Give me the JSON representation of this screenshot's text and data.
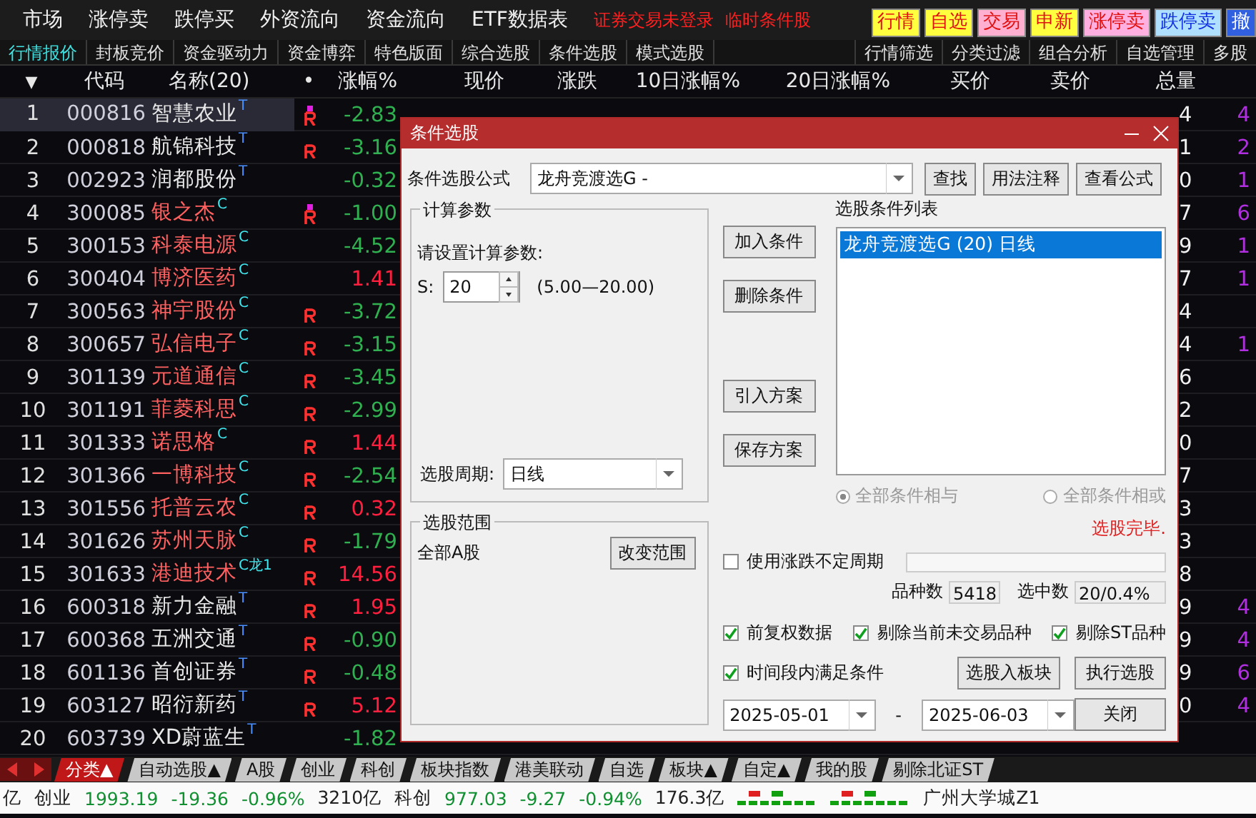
{
  "menu": {
    "items": [
      "市场",
      "涨停卖",
      "跌停买",
      "外资流向",
      "资金流向",
      "ETF数据表"
    ],
    "notices": [
      {
        "text": "证券交易未登录",
        "color": "#ff2020"
      },
      {
        "text": "临时条件股",
        "color": "#ff2020"
      }
    ],
    "quick_buttons": [
      {
        "label": "行情",
        "color": "#ffff40",
        "kind": "warm"
      },
      {
        "label": "自选",
        "color": "#ffff40",
        "kind": "warm"
      },
      {
        "label": "交易",
        "color": "#ffb0d0",
        "kind": "warm"
      },
      {
        "label": "申新",
        "color": "#ffff40",
        "kind": "warm"
      },
      {
        "label": "涨停卖",
        "color": "#ffb0e0",
        "kind": "warm"
      },
      {
        "label": "跌停卖",
        "color": "#b0e0ff",
        "kind": "cool"
      },
      {
        "label": "撤",
        "color": "#3060e0",
        "kind": "solid"
      }
    ]
  },
  "view_tabs": [
    {
      "label": "行情报价",
      "selected": true
    },
    {
      "label": "封板竞价",
      "selected": false
    },
    {
      "label": "资金驱动力",
      "selected": false
    },
    {
      "label": "资金博弈",
      "selected": false
    },
    {
      "label": "特色版面",
      "selected": false
    },
    {
      "label": "综合选股",
      "selected": false
    },
    {
      "label": "条件选股",
      "selected": false
    },
    {
      "label": "模式选股",
      "selected": false
    }
  ],
  "tools": [
    "行情筛选",
    "分类过滤",
    "组合分析",
    "自选管理",
    "多股"
  ],
  "table": {
    "columns": [
      "▼",
      "代码",
      "名称(20)",
      "•",
      "涨幅%",
      "现价",
      "涨跌",
      "10日涨幅%",
      "20日涨幅%",
      "买价",
      "卖价",
      "总量"
    ],
    "rows": [
      {
        "no": "1",
        "code": "000816",
        "selected": true,
        "name": {
          "text": "智慧农业",
          "color": "#e8e8e8"
        },
        "tag": {
          "text": "T",
          "color": "#4a90ff"
        },
        "r_badge": true,
        "dot": true,
        "change": {
          "text": "-2.83",
          "color": "#30b050"
        },
        "tail": "4",
        "tail_2": "4"
      },
      {
        "no": "2",
        "code": "000818",
        "selected": false,
        "name": {
          "text": "航锦科技",
          "color": "#e8e8e8"
        },
        "tag": {
          "text": "T",
          "color": "#4a90ff"
        },
        "r_badge": true,
        "dot": false,
        "change": {
          "text": "-3.16",
          "color": "#30b050"
        },
        "tail": "1",
        "tail_2": "2"
      },
      {
        "no": "3",
        "code": "002923",
        "selected": false,
        "name": {
          "text": "润都股份",
          "color": "#e8e8e8"
        },
        "tag": {
          "text": "T",
          "color": "#4a90ff"
        },
        "r_badge": false,
        "dot": false,
        "change": {
          "text": "-0.32",
          "color": "#30b050"
        },
        "tail": "0",
        "tail_2": "1"
      },
      {
        "no": "4",
        "code": "300085",
        "selected": false,
        "name": {
          "text": "银之杰",
          "color": "#ff6060"
        },
        "tag": {
          "text": "C",
          "color": "#40e8f0"
        },
        "r_badge": true,
        "dot": true,
        "change": {
          "text": "-1.00",
          "color": "#30b050"
        },
        "tail": "7",
        "tail_2": "6"
      },
      {
        "no": "5",
        "code": "300153",
        "selected": false,
        "name": {
          "text": "科泰电源",
          "color": "#ff6060"
        },
        "tag": {
          "text": "C",
          "color": "#40e8f0"
        },
        "r_badge": false,
        "dot": false,
        "change": {
          "text": "-4.52",
          "color": "#30b050"
        },
        "tail": "9",
        "tail_2": "1"
      },
      {
        "no": "6",
        "code": "300404",
        "selected": false,
        "name": {
          "text": "博济医药",
          "color": "#ff6060"
        },
        "tag": {
          "text": "C",
          "color": "#40e8f0"
        },
        "r_badge": false,
        "dot": false,
        "change": {
          "text": "1.41",
          "color": "#ff2040"
        },
        "tail": "7",
        "tail_2": "1"
      },
      {
        "no": "7",
        "code": "300563",
        "selected": false,
        "name": {
          "text": "神宇股份",
          "color": "#ff6060"
        },
        "tag": {
          "text": "C",
          "color": "#40e8f0"
        },
        "r_badge": true,
        "dot": false,
        "change": {
          "text": "-3.72",
          "color": "#30b050"
        },
        "tail": "4"
      },
      {
        "no": "8",
        "code": "300657",
        "selected": false,
        "name": {
          "text": "弘信电子",
          "color": "#ff6060"
        },
        "tag": {
          "text": "C",
          "color": "#40e8f0"
        },
        "r_badge": true,
        "dot": false,
        "change": {
          "text": "-3.15",
          "color": "#30b050"
        },
        "tail": "4",
        "tail_2": "1"
      },
      {
        "no": "9",
        "code": "301139",
        "selected": false,
        "name": {
          "text": "元道通信",
          "color": "#ff6060"
        },
        "tag": {
          "text": "C",
          "color": "#40e8f0"
        },
        "r_badge": true,
        "dot": false,
        "change": {
          "text": "-3.45",
          "color": "#30b050"
        },
        "tail": "6"
      },
      {
        "no": "10",
        "code": "301191",
        "selected": false,
        "name": {
          "text": "菲菱科思",
          "color": "#ff6060"
        },
        "tag": {
          "text": "C",
          "color": "#40e8f0"
        },
        "r_badge": true,
        "dot": false,
        "change": {
          "text": "-2.99",
          "color": "#30b050"
        },
        "tail": "2"
      },
      {
        "no": "11",
        "code": "301333",
        "selected": false,
        "name": {
          "text": "诺思格",
          "color": "#ff6060"
        },
        "tag": {
          "text": "C",
          "color": "#40e8f0"
        },
        "r_badge": true,
        "dot": false,
        "change": {
          "text": "1.44",
          "color": "#ff2040"
        },
        "tail": "0"
      },
      {
        "no": "12",
        "code": "301366",
        "selected": false,
        "name": {
          "text": "一博科技",
          "color": "#ff6060"
        },
        "tag": {
          "text": "C",
          "color": "#40e8f0"
        },
        "r_badge": true,
        "dot": false,
        "change": {
          "text": "-2.54",
          "color": "#30b050"
        },
        "tail": "7"
      },
      {
        "no": "13",
        "code": "301556",
        "selected": false,
        "name": {
          "text": "托普云农",
          "color": "#ff6060"
        },
        "tag": {
          "text": "C",
          "color": "#40e8f0"
        },
        "r_badge": true,
        "dot": false,
        "change": {
          "text": "0.32",
          "color": "#ff2040"
        },
        "tail": "3"
      },
      {
        "no": "14",
        "code": "301626",
        "selected": false,
        "name": {
          "text": "苏州天脉",
          "color": "#ff6060"
        },
        "tag": {
          "text": "C",
          "color": "#40e8f0"
        },
        "r_badge": true,
        "dot": false,
        "change": {
          "text": "-1.79",
          "color": "#30b050"
        },
        "tail": "3"
      },
      {
        "no": "15",
        "code": "301633",
        "selected": false,
        "name": {
          "text": "港迪技术",
          "color": "#ff6060"
        },
        "tag": {
          "text": "C龙1",
          "color": "#40e8f0"
        },
        "r_badge": true,
        "dot": false,
        "change": {
          "text": "14.56",
          "color": "#ff2040"
        },
        "tail": "8"
      },
      {
        "no": "16",
        "code": "600318",
        "selected": false,
        "name": {
          "text": "新力金融",
          "color": "#e8e8e8"
        },
        "tag": {
          "text": "T",
          "color": "#4a90ff"
        },
        "r_badge": true,
        "dot": false,
        "change": {
          "text": "1.95",
          "color": "#ff2040"
        },
        "tail": "9",
        "tail_2": "4"
      },
      {
        "no": "17",
        "code": "600368",
        "selected": false,
        "name": {
          "text": "五洲交通",
          "color": "#e8e8e8"
        },
        "tag": {
          "text": "T",
          "color": "#4a90ff"
        },
        "r_badge": true,
        "dot": false,
        "change": {
          "text": "-0.90",
          "color": "#30b050"
        },
        "tail": "9",
        "tail_2": "4"
      },
      {
        "no": "18",
        "code": "601136",
        "selected": false,
        "name": {
          "text": "首创证券",
          "color": "#e8e8e8"
        },
        "tag": {
          "text": "T",
          "color": "#4a90ff"
        },
        "r_badge": true,
        "dot": false,
        "change": {
          "text": "-0.48",
          "color": "#30b050"
        },
        "tail": "9",
        "tail_2": "6"
      },
      {
        "no": "19",
        "code": "603127",
        "selected": false,
        "name": {
          "text": "昭衍新药",
          "color": "#e8e8e8"
        },
        "tag": {
          "text": "T",
          "color": "#4a90ff"
        },
        "r_badge": true,
        "dot": false,
        "change": {
          "text": "5.12",
          "color": "#ff2040"
        },
        "tail": "0",
        "tail_2": "4"
      },
      {
        "no": "20",
        "code": "603739",
        "selected": false,
        "name": {
          "text": "XD蔚蓝生",
          "color": "#e8e8e8"
        },
        "tag": {
          "text": "T",
          "color": "#4a90ff"
        },
        "r_badge": false,
        "dot": false,
        "change": {
          "text": "-1.82",
          "color": "#30b050"
        }
      }
    ]
  },
  "bottom_tabs": [
    {
      "label": "分类▲",
      "selected": true
    },
    {
      "label": "自动选股▲",
      "selected": false
    },
    {
      "label": "A股",
      "selected": false
    },
    {
      "label": "创业",
      "selected": false
    },
    {
      "label": "科创",
      "selected": false
    },
    {
      "label": "板块指数",
      "selected": false
    },
    {
      "label": "港美联动",
      "selected": false
    },
    {
      "label": "自选",
      "selected": false
    },
    {
      "label": "板块▲",
      "selected": false
    },
    {
      "label": "自定▲",
      "selected": false
    },
    {
      "label": "我的股",
      "selected": false
    },
    {
      "label": "剔除北证ST",
      "selected": false
    }
  ],
  "status_items": [
    {
      "kind": "text",
      "text": "亿",
      "color": "#202020"
    },
    {
      "kind": "text",
      "text": "创业",
      "color": "#202020"
    },
    {
      "kind": "text",
      "text": "1993.19",
      "color": "#109030"
    },
    {
      "kind": "text",
      "text": "-19.36",
      "color": "#109030"
    },
    {
      "kind": "text",
      "text": "-0.96%",
      "color": "#109030"
    },
    {
      "kind": "text",
      "text": "3210亿",
      "color": "#202020"
    },
    {
      "kind": "text",
      "text": "科创",
      "color": "#202020"
    },
    {
      "kind": "text",
      "text": "977.03",
      "color": "#109030"
    },
    {
      "kind": "text",
      "text": "-9.27",
      "color": "#109030"
    },
    {
      "kind": "text",
      "text": "-0.94%",
      "color": "#109030"
    },
    {
      "kind": "text",
      "text": "176.3亿",
      "color": "#202020"
    },
    {
      "kind": "bars"
    },
    {
      "kind": "bars"
    },
    {
      "kind": "text",
      "text": "广州大学城Z1",
      "color": "#202020"
    }
  ],
  "dialog": {
    "title": "条件选股",
    "formula_label": "条件选股公式",
    "formula_value": "龙舟竞渡选G  -",
    "top_buttons": [
      "查找",
      "用法注释",
      "查看公式"
    ],
    "params": {
      "legend": "计算参数",
      "prompt": "请设置计算参数:",
      "label": "S:",
      "value": "20",
      "range": "(5.00—20.00)"
    },
    "period": {
      "label": "选股周期:",
      "value": "日线"
    },
    "scope": {
      "legend": "选股范围",
      "value": "全部A股",
      "button": "改变范围"
    },
    "side_buttons": [
      "加入条件",
      "删除条件",
      "引入方案",
      "保存方案"
    ],
    "list": {
      "label": "选股条件列表",
      "items": [
        {
          "text": "龙舟竞渡选G (20) 日线",
          "selected": true
        }
      ]
    },
    "logic": [
      {
        "label": "全部条件相与",
        "selected": true,
        "disabled": true
      },
      {
        "label": "全部条件相或",
        "selected": false,
        "disabled": true
      }
    ],
    "message": "选股完毕.",
    "variable_period": {
      "label": "使用涨跌不定周期",
      "checked": false
    },
    "counts": [
      {
        "label": "品种数",
        "value": "5418"
      },
      {
        "label": "选中数",
        "value": "20/0.4%"
      }
    ],
    "options": [
      {
        "label": "前复权数据",
        "checked": true
      },
      {
        "label": "剔除当前未交易品种",
        "checked": true
      },
      {
        "label": "剔除ST品种",
        "checked": true
      }
    ],
    "within_period": {
      "label": "时间段内满足条件",
      "checked": true
    },
    "action_buttons": [
      "选股入板块",
      "执行选股"
    ],
    "dates": [
      "2025-05-01",
      "2025-06-03"
    ],
    "date_separator": "-",
    "close_button": "关闭"
  }
}
